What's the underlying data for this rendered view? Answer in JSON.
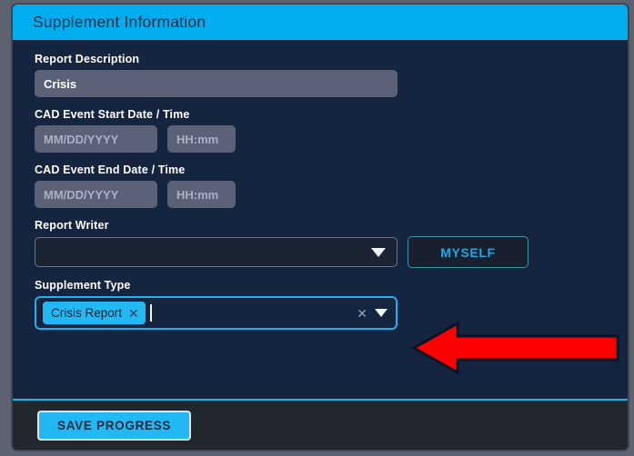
{
  "panel": {
    "header_title": "Supplement Information",
    "accent_color": "#00aeef",
    "body_bg": "#16253f",
    "footer_bg": "#22262d"
  },
  "form": {
    "report_description": {
      "label": "Report Description",
      "value": "Crisis",
      "placeholder": ""
    },
    "cad_start": {
      "label": "CAD Event Start Date / Time",
      "date_value": "",
      "date_placeholder": "MM/DD/YYYY",
      "time_value": "",
      "time_placeholder": "HH:mm"
    },
    "cad_end": {
      "label": "CAD Event End Date / Time",
      "date_value": "",
      "date_placeholder": "MM/DD/YYYY",
      "time_value": "",
      "time_placeholder": "HH:mm"
    },
    "report_writer": {
      "label": "Report Writer",
      "selected": "",
      "caret_icon": "chevron-down-icon",
      "myself_button": "MYSELF"
    },
    "supplement_type": {
      "label": "Supplement Type",
      "chips": [
        {
          "text": "Crisis Report",
          "remove_icon": "close-icon"
        }
      ],
      "clear_icon": "close-icon",
      "caret_icon": "chevron-down-icon",
      "focused": true
    }
  },
  "footer": {
    "save_button": "SAVE PROGRESS"
  },
  "annotation": {
    "arrow_icon": "left-arrow-icon",
    "color": "#fe0000",
    "direction": "left"
  }
}
